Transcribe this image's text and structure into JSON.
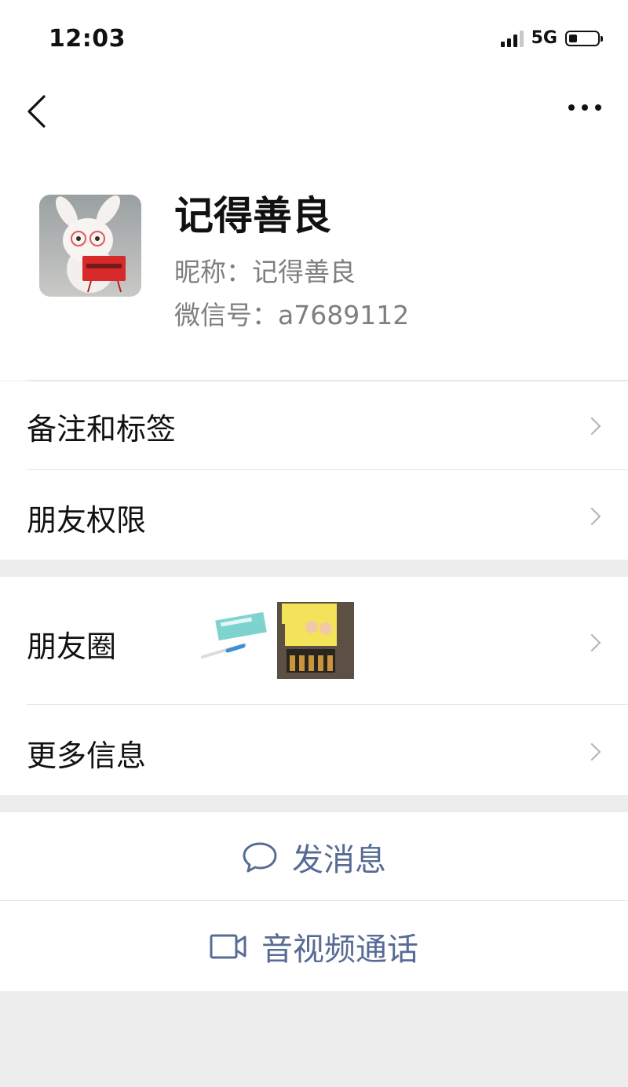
{
  "status_bar": {
    "time": "12:03",
    "network": "5G",
    "battery_level": 0.25
  },
  "nav": {
    "back_icon": "chevron-left-icon",
    "more_icon": "more-dots-icon"
  },
  "profile": {
    "name": "记得善良",
    "nickname_line": "昵称：记得善良",
    "wechat_id_line": "微信号：a7689112"
  },
  "menu": {
    "remarks_tags": "备注和标签",
    "friend_permissions": "朋友权限",
    "moments": "朋友圈",
    "more_info": "更多信息"
  },
  "actions": {
    "send_message": "发消息",
    "video_call": "音视频通话"
  },
  "colors": {
    "link_blue": "#576b95",
    "background": "#ededed",
    "chevron": "#b3b3b3"
  }
}
